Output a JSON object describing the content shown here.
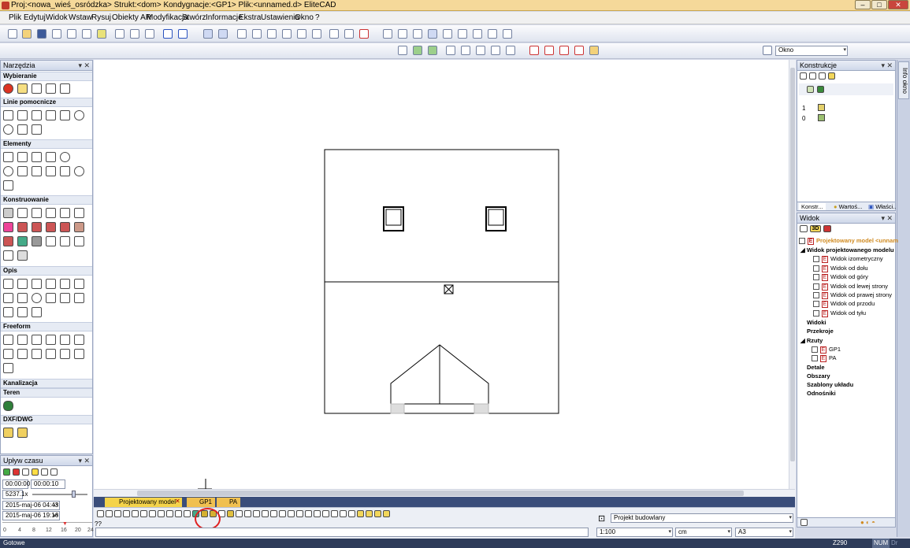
{
  "window": {
    "title": "Proj:<nowa_wieś_osródzka> Strukt:<dom> Kondygnacje:<GP1> Plik:<unnamed.d> EliteCAD",
    "minimize": "–",
    "restore": "□",
    "close": "✕"
  },
  "menu": [
    "Plik",
    "Edytuj",
    "Widok",
    "Wstaw",
    "Rysuj",
    "Obiekty AR",
    "Modyfikacja",
    "Stwórz",
    "Informacje",
    "Ekstra",
    "Ustawienia",
    "Okno",
    "?"
  ],
  "toolbar": {
    "layer_combo": "Okno"
  },
  "tools_panel": {
    "title": "Narzędzia",
    "sections": [
      "Wybieranie",
      "Linie pomocnicze",
      "Elementy",
      "Konstruowanie",
      "Opis",
      "Freeform",
      "Kanalizacja",
      "Teren",
      "DXF/DWG"
    ]
  },
  "time_panel": {
    "title": "Upływ czasu",
    "time_from": "00:00:00",
    "time_to": "00:00:10",
    "speed": "5237.1x",
    "date_start": "2015-maj-06 04:43",
    "date_end": "2015-maj-06 19:16",
    "ruler": [
      "0",
      "4",
      "8",
      "12",
      "16",
      "20",
      "24"
    ]
  },
  "drawing_tabs": [
    "Projektowany model",
    "GP1",
    "PA"
  ],
  "bottom": {
    "command_prompt": "??",
    "view_combo": "Projekt budowlany",
    "scale_combo": "1:100",
    "unit_combo": "cm",
    "paper_combo": "A3"
  },
  "construct_panel": {
    "title": "Konstrukcje",
    "levels": [
      "1",
      "0"
    ],
    "tabs": [
      "Konstr...",
      "Wartoś...",
      "Właści..."
    ]
  },
  "side_rail_label": "Info okno",
  "view_panel": {
    "title": "Widok",
    "root": "Projektowany model <unnam",
    "group_model": "Widok projektowanego modelu",
    "model_views": [
      "Widok izometryczny",
      "Widok od dołu",
      "Widok od góry",
      "Widok od lewej strony",
      "Widok od prawej strony",
      "Widok od przodu",
      "Widok od tyłu"
    ],
    "sec_widoki": "Widoki",
    "sec_przekroje": "Przekroje",
    "sec_rzuty": "Rzuty",
    "rzuty_items": [
      "GP1",
      "PA"
    ],
    "sec_detale": "Detale",
    "sec_obszary": "Obszary",
    "sec_szablony": "Szablony układu",
    "sec_odnosniki": "Odnośniki"
  },
  "statusbar": {
    "left": "Gotowe",
    "coord": "Z290",
    "num": "NUM",
    "extra": "Dr"
  },
  "colors": {
    "highlight_circle": "#e02020",
    "tab_active": "#f4d34a",
    "status_bg": "#2e3c5a"
  }
}
